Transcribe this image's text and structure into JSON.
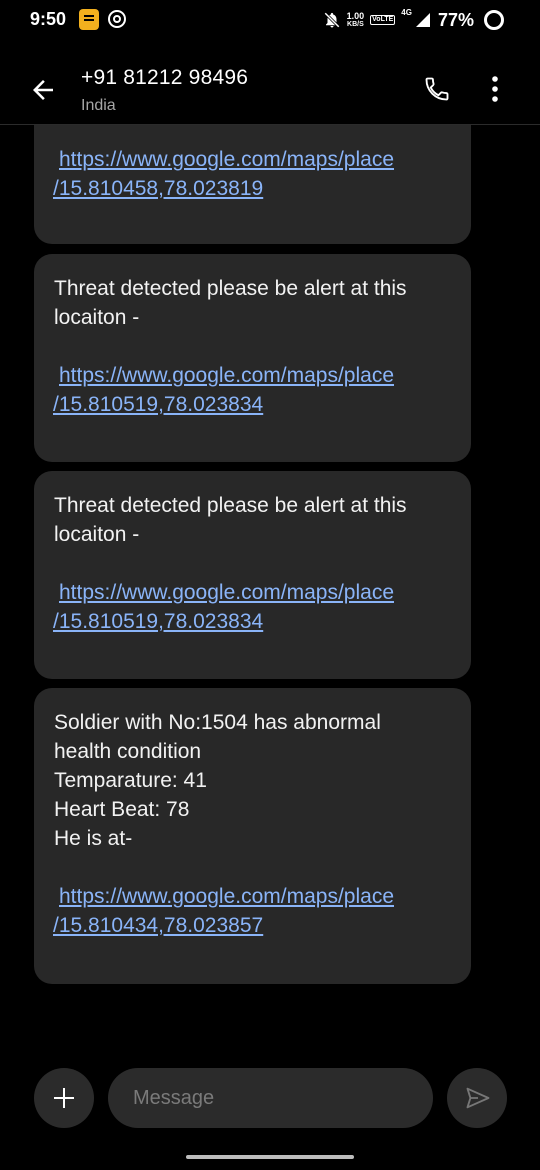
{
  "status_bar": {
    "time": "9:50",
    "net_speed_value": "1.00",
    "net_speed_unit": "KB/S",
    "volte": "VoLTE",
    "network": "4G",
    "battery": "77%"
  },
  "header": {
    "contact_number": "+91 81212 98496",
    "contact_region": "India"
  },
  "messages": [
    {
      "text": "",
      "link_line1": "https://www.google.com/maps/place",
      "link_line2": "/15.810458,78.023819"
    },
    {
      "text": "Threat detected please be alert at this\nlocaiton -",
      "link_line1": "https://www.google.com/maps/place",
      "link_line2": "/15.810519,78.023834"
    },
    {
      "text": "Threat detected please be alert at this\nlocaiton -",
      "link_line1": "https://www.google.com/maps/place",
      "link_line2": "/15.810519,78.023834"
    },
    {
      "text": "Soldier with No:1504 has abnormal\nhealth condition\nTemparature: 41\nHeart Beat: 78\nHe is at-",
      "link_line1": "https://www.google.com/maps/place",
      "link_line2": "/15.810434,78.023857"
    }
  ],
  "composer": {
    "placeholder": "Message"
  },
  "icons": {
    "back": "arrow-left-icon",
    "call": "phone-icon",
    "more": "more-vert-icon",
    "add": "plus-icon",
    "send": "send-icon"
  },
  "colors": {
    "background": "#000000",
    "bubble": "#282828",
    "link": "#8ab4f8",
    "notification_app": "#f2b01e"
  }
}
